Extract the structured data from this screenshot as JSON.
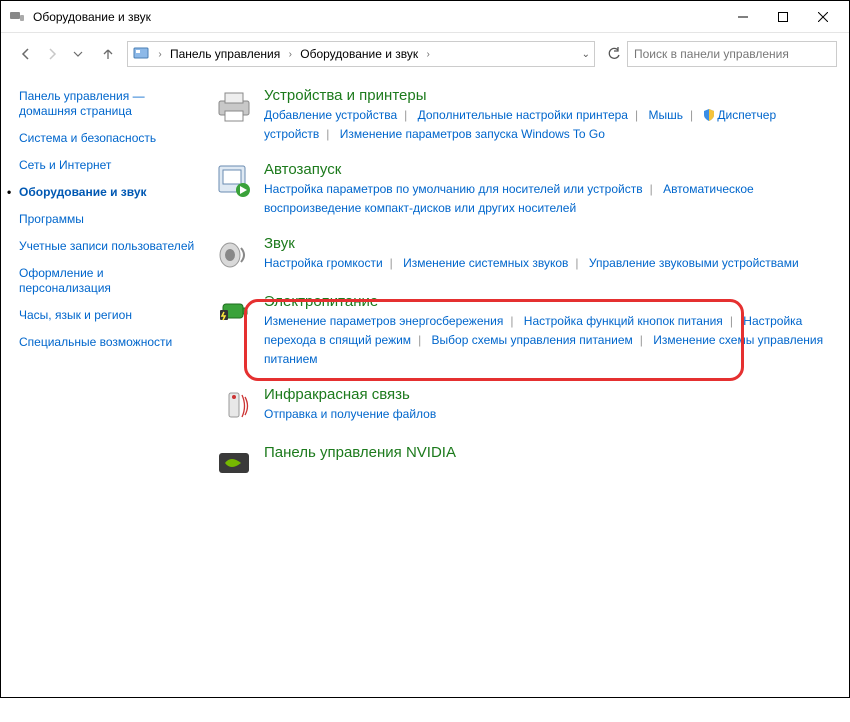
{
  "window": {
    "title": "Оборудование и звук"
  },
  "nav": {
    "segments": [
      "Панель управления",
      "Оборудование и звук"
    ],
    "search_placeholder": "Поиск в панели управления"
  },
  "sidebar": {
    "items": [
      "Панель управления — домашняя страница",
      "Система и безопасность",
      "Сеть и Интернет",
      "Оборудование и звук",
      "Программы",
      "Учетные записи пользователей",
      "Оформление и персонализация",
      "Часы, язык и регион",
      "Специальные возможности"
    ],
    "selected_index": 3
  },
  "categories": {
    "devices": {
      "title": "Устройства и принтеры",
      "links": [
        "Добавление устройства",
        "Дополнительные настройки принтера",
        "Мышь",
        "Диспетчер устройств",
        "Изменение параметров запуска Windows To Go"
      ]
    },
    "autoplay": {
      "title": "Автозапуск",
      "links": [
        "Настройка параметров по умолчанию для носителей или устройств",
        "Автоматическое воспроизведение компакт-дисков или других носителей"
      ]
    },
    "sound": {
      "title": "Звук",
      "links": [
        "Настройка громкости",
        "Изменение системных звуков",
        "Управление звуковыми устройствами"
      ]
    },
    "power": {
      "title": "Электропитание",
      "links": [
        "Изменение параметров энергосбережения",
        "Настройка функций кнопок питания",
        "Настройка перехода в спящий режим",
        "Выбор схемы управления питанием",
        "Изменение схемы управления питанием"
      ]
    },
    "infrared": {
      "title": "Инфракрасная связь",
      "links": [
        "Отправка и получение файлов"
      ]
    },
    "nvidia": {
      "title": "Панель управления NVIDIA"
    }
  }
}
